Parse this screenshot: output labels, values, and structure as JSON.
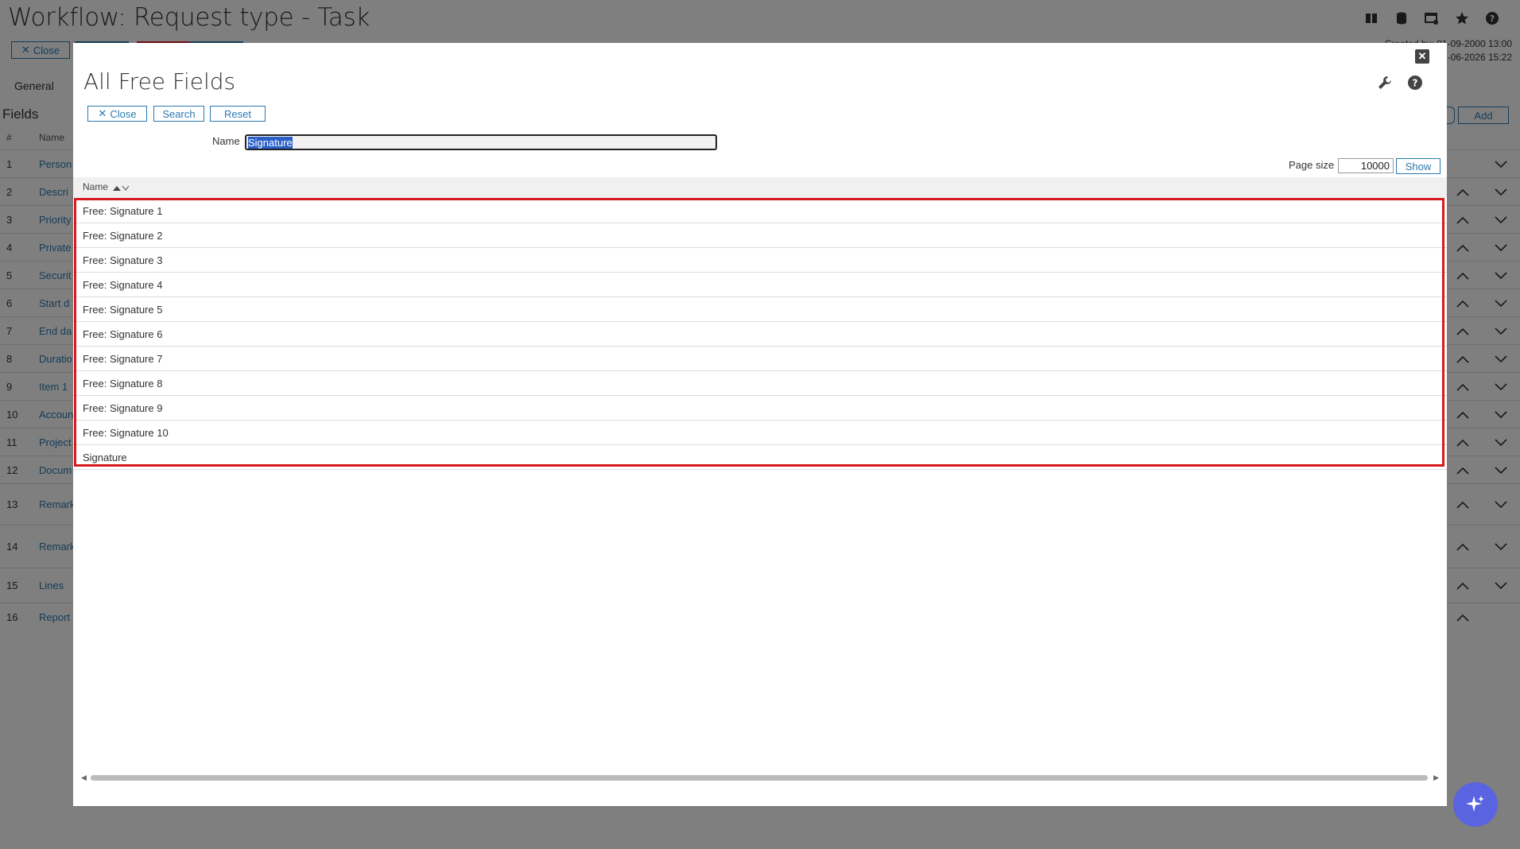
{
  "page": {
    "title": "Workflow: Request type - Task",
    "close_label": "Close",
    "created_line1": "Created by: 01-09-2000 13:00",
    "created_line2": "-06-2026 15:22",
    "tab_general": "General",
    "fields_heading": "Fields",
    "col_num": "#",
    "col_name": "Name",
    "add_label": "Add",
    "field_rows": [
      {
        "n": "1",
        "label": "Person"
      },
      {
        "n": "2",
        "label": "Descri"
      },
      {
        "n": "3",
        "label": "Priority"
      },
      {
        "n": "4",
        "label": "Private"
      },
      {
        "n": "5",
        "label": "Securit"
      },
      {
        "n": "6",
        "label": "Start d"
      },
      {
        "n": "7",
        "label": "End da"
      },
      {
        "n": "8",
        "label": "Duratio"
      },
      {
        "n": "9",
        "label": "Item 1"
      },
      {
        "n": "10",
        "label": "Accoun"
      },
      {
        "n": "11",
        "label": "Project"
      },
      {
        "n": "12",
        "label": "Docum"
      },
      {
        "n": "13",
        "label": "Remark"
      },
      {
        "n": "14",
        "label": "Remark"
      },
      {
        "n": "15",
        "label": "Lines"
      },
      {
        "n": "16",
        "label": "Report"
      }
    ]
  },
  "modal": {
    "title": "All Free Fields",
    "buttons": {
      "close": "Close",
      "search": "Search",
      "reset": "Reset"
    },
    "name_label": "Name",
    "name_value": "Signature",
    "page_size_label": "Page size",
    "page_size_value": "10000",
    "show_label": "Show",
    "column_header": "Name",
    "rows": [
      "Free: Signature 1",
      "Free: Signature 2",
      "Free: Signature 3",
      "Free: Signature 4",
      "Free: Signature 5",
      "Free: Signature 6",
      "Free: Signature 7",
      "Free: Signature 8",
      "Free: Signature 9",
      "Free: Signature 10",
      "Signature"
    ]
  },
  "colors": {
    "accent": "#2a7ab0",
    "highlight": "#d71920",
    "fab": "#5a63e0"
  }
}
